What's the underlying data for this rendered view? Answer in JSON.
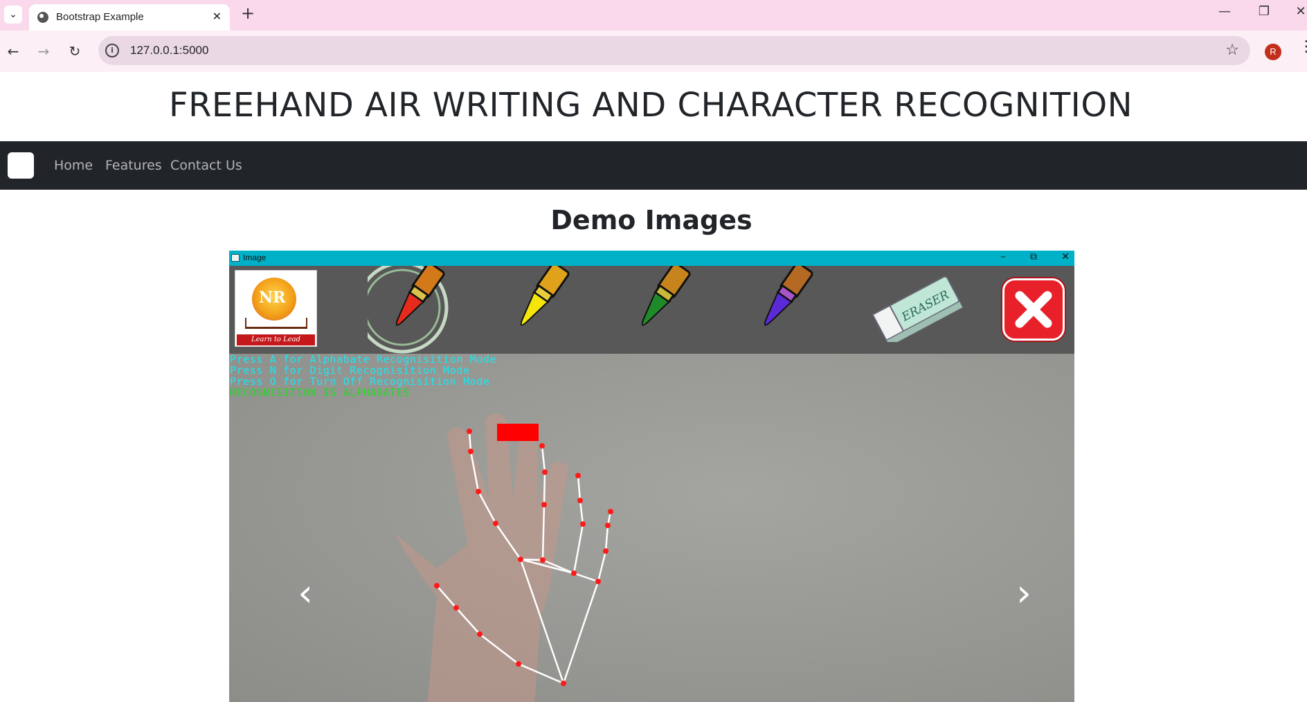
{
  "browser": {
    "tab_title": "Bootstrap Example",
    "tab_close": "✕",
    "new_tab": "+",
    "url": "127.0.0.1:5000",
    "profile_initial": "R",
    "minimize": "—",
    "restore": "❐",
    "close": "✕",
    "back": "←",
    "forward": "→",
    "reload": "↻",
    "star": "☆",
    "menu": "⋮",
    "tab_list": "⌄"
  },
  "page": {
    "title": "FREEHAND AIR WRITING AND CHARACTER RECOGNITION",
    "nav": [
      "Home",
      "Features",
      "Contact Us"
    ],
    "section_title": "Demo Images"
  },
  "demo_window": {
    "title": "Image",
    "minimize": "–",
    "restore": "⧉",
    "close": "✕",
    "logo_text": "NR",
    "logo_tagline": "Learn to Lead",
    "instructions": [
      "Press A for Alphabate Recognisition Mode",
      "Press N for Digit Recognisition Mode",
      "Press O for Turn Off Recognisition Mode"
    ],
    "status": "RECOGNISITION IS ALPHABATES",
    "eraser_label": "ERASER",
    "pen_colors": [
      "#e62a1c",
      "#f5e50a",
      "#1f8a2a",
      "#5a2ad6"
    ],
    "prev": "‹",
    "next": "›"
  },
  "colors": {
    "navbar_bg": "#212529",
    "tabbar_bg": "#f9d9eb",
    "window_title_bg": "#00b1c8",
    "instruction_text": "#1ae6f2",
    "status_text": "#27d62a"
  }
}
